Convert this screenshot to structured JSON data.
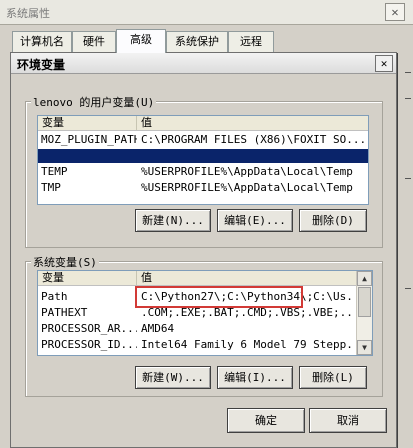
{
  "system_window": {
    "title": "系统属性",
    "close_glyph": "✕",
    "tabs": [
      "计算机名",
      "硬件",
      "高级",
      "系统保护",
      "远程"
    ]
  },
  "dialog": {
    "title": "环境变量",
    "close_glyph": "✕",
    "user_section": {
      "label": "lenovo 的用户变量(U)",
      "columns": [
        "变量",
        "值"
      ],
      "rows": [
        {
          "name": "MOZ_PLUGIN_PATH",
          "value": "C:\\PROGRAM FILES (X86)\\FOXIT SO..."
        },
        {
          "name": "",
          "value": ""
        },
        {
          "name": "TEMP",
          "value": "%USERPROFILE%\\AppData\\Local\\Temp"
        },
        {
          "name": "TMP",
          "value": "%USERPROFILE%\\AppData\\Local\\Temp"
        }
      ],
      "buttons": {
        "new": "新建(N)...",
        "edit": "编辑(E)...",
        "delete": "删除(D)"
      }
    },
    "system_section": {
      "label": "系统变量(S)",
      "columns": [
        "变量",
        "值"
      ],
      "rows": [
        {
          "name": "Path",
          "value": "C:\\Python27\\;C:\\Python34\\;C:\\Us..."
        },
        {
          "name": "PATHEXT",
          "value": ".COM;.EXE;.BAT;.CMD;.VBS;.VBE;..."
        },
        {
          "name": "PROCESSOR_AR...",
          "value": "AMD64"
        },
        {
          "name": "PROCESSOR_ID...",
          "value": "Intel64 Family 6 Model 79 Stepp..."
        }
      ],
      "buttons": {
        "new": "新建(W)...",
        "edit": "编辑(I)...",
        "delete": "删除(L)"
      },
      "scroll_up": "▲",
      "scroll_down": "▼"
    },
    "ok_label": "确定",
    "cancel_label": "取消"
  }
}
